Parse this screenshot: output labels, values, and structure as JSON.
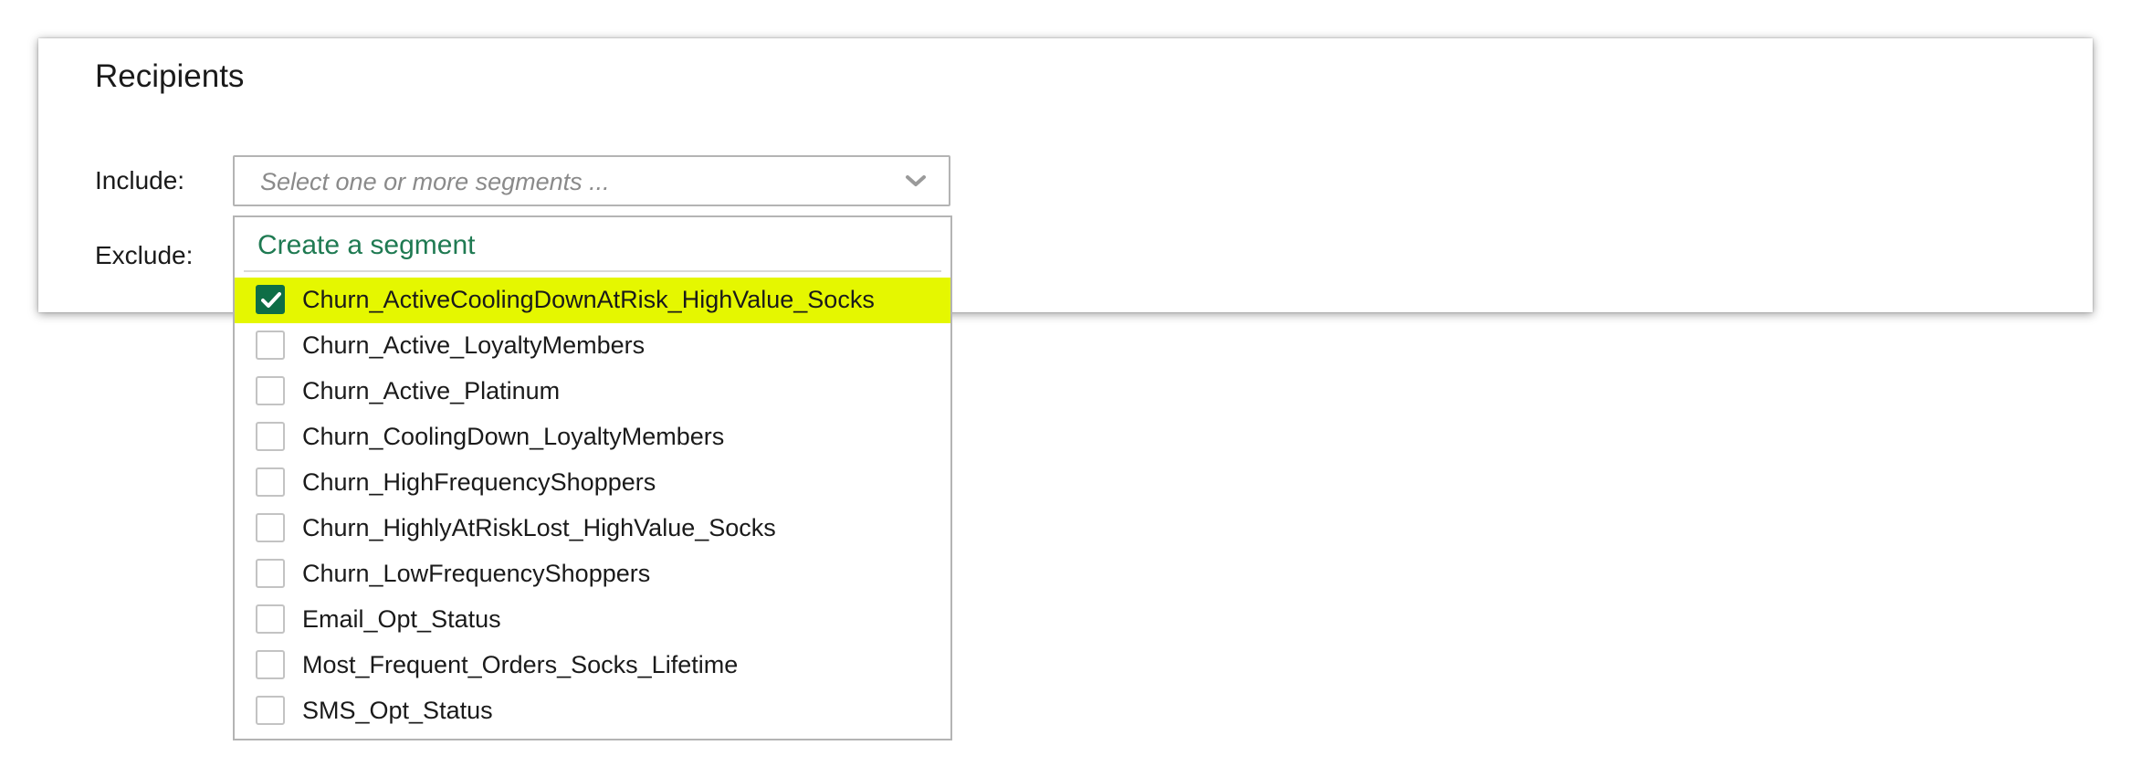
{
  "recipients": {
    "title": "Recipients",
    "include_label": "Include:",
    "exclude_label": "Exclude:",
    "include_select": {
      "placeholder": "Select one or more segments ...",
      "icon": "chevron-down-icon"
    },
    "dropdown": {
      "create_link": "Create a segment",
      "options": [
        {
          "label": "Churn_ActiveCoolingDownAtRisk_HighValue_Socks",
          "checked": true
        },
        {
          "label": "Churn_Active_LoyaltyMembers",
          "checked": false
        },
        {
          "label": "Churn_Active_Platinum",
          "checked": false
        },
        {
          "label": "Churn_CoolingDown_LoyaltyMembers",
          "checked": false
        },
        {
          "label": "Churn_HighFrequencyShoppers",
          "checked": false
        },
        {
          "label": "Churn_HighlyAtRiskLost_HighValue_Socks",
          "checked": false
        },
        {
          "label": "Churn_LowFrequencyShoppers",
          "checked": false
        },
        {
          "label": "Email_Opt_Status",
          "checked": false
        },
        {
          "label": "Most_Frequent_Orders_Socks_Lifetime",
          "checked": false
        },
        {
          "label": "SMS_Opt_Status",
          "checked": false
        }
      ]
    }
  },
  "colors": {
    "accent_green": "#1f7a52",
    "checkbox_checked": "#0e6e46",
    "highlight": "#e5f700",
    "border": "#b4b4b4"
  }
}
